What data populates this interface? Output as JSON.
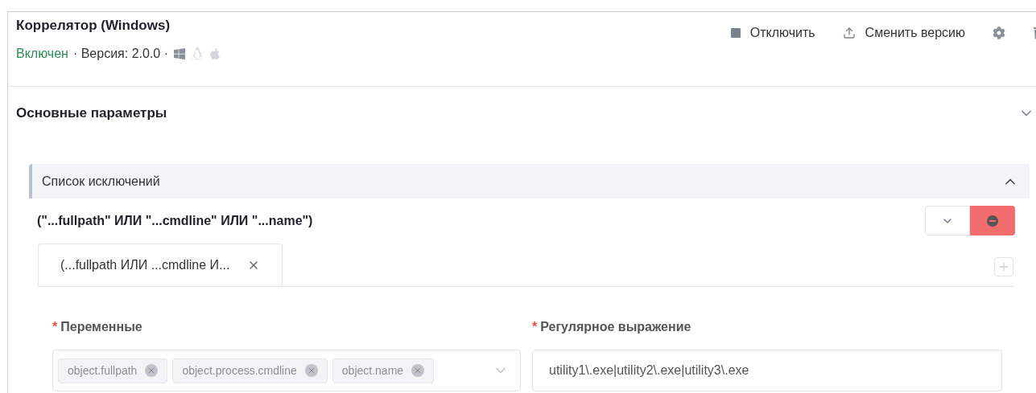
{
  "header": {
    "title": "Коррелятор (Windows)",
    "status": "Включен",
    "status_on": true,
    "version": "· Версия: 2.0.0 ·",
    "platforms": [
      {
        "kind": "windows",
        "active": true
      },
      {
        "kind": "linux",
        "active": false
      },
      {
        "kind": "apple",
        "active": false
      }
    ],
    "actions": [
      {
        "kind": "stop",
        "label": "Отключить"
      },
      {
        "kind": "upload",
        "label": "Сменить версию"
      }
    ]
  },
  "section": {
    "title": "Основные параметры",
    "expanded": true
  },
  "panel": {
    "title": "Список исключений",
    "expanded": true,
    "rule": {
      "title": "(\"...fullpath\" ИЛИ \"...cmdline\" ИЛИ \"...name\")",
      "tabs": [
        {
          "label": "(...fullpath ИЛИ ...cmdline И...",
          "selected": true
        }
      ],
      "fields": [
        {
          "kind": "tags",
          "label": "Переменные",
          "required_mark": "*",
          "tags": [
            "object.fullpath",
            "object.process.cmdline",
            "object.name"
          ]
        },
        {
          "kind": "text",
          "label": "Регулярное выражение",
          "required_mark": "*",
          "value": "utility1\\.exe|utility2\\.exe|utility3\\.exe"
        }
      ]
    }
  }
}
